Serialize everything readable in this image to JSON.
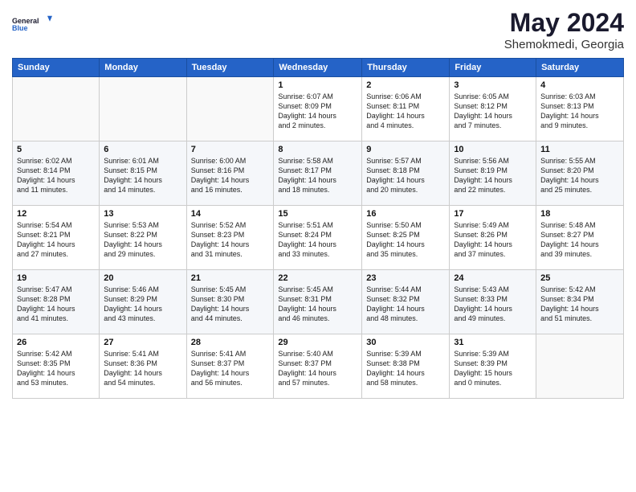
{
  "header": {
    "monthYear": "May 2024",
    "location": "Shemokmedi, Georgia"
  },
  "calendar": {
    "headers": [
      "Sunday",
      "Monday",
      "Tuesday",
      "Wednesday",
      "Thursday",
      "Friday",
      "Saturday"
    ]
  },
  "weeks": [
    [
      {
        "day": "",
        "info": ""
      },
      {
        "day": "",
        "info": ""
      },
      {
        "day": "",
        "info": ""
      },
      {
        "day": "1",
        "info": "Sunrise: 6:07 AM\nSunset: 8:09 PM\nDaylight: 14 hours\nand 2 minutes."
      },
      {
        "day": "2",
        "info": "Sunrise: 6:06 AM\nSunset: 8:11 PM\nDaylight: 14 hours\nand 4 minutes."
      },
      {
        "day": "3",
        "info": "Sunrise: 6:05 AM\nSunset: 8:12 PM\nDaylight: 14 hours\nand 7 minutes."
      },
      {
        "day": "4",
        "info": "Sunrise: 6:03 AM\nSunset: 8:13 PM\nDaylight: 14 hours\nand 9 minutes."
      }
    ],
    [
      {
        "day": "5",
        "info": "Sunrise: 6:02 AM\nSunset: 8:14 PM\nDaylight: 14 hours\nand 11 minutes."
      },
      {
        "day": "6",
        "info": "Sunrise: 6:01 AM\nSunset: 8:15 PM\nDaylight: 14 hours\nand 14 minutes."
      },
      {
        "day": "7",
        "info": "Sunrise: 6:00 AM\nSunset: 8:16 PM\nDaylight: 14 hours\nand 16 minutes."
      },
      {
        "day": "8",
        "info": "Sunrise: 5:58 AM\nSunset: 8:17 PM\nDaylight: 14 hours\nand 18 minutes."
      },
      {
        "day": "9",
        "info": "Sunrise: 5:57 AM\nSunset: 8:18 PM\nDaylight: 14 hours\nand 20 minutes."
      },
      {
        "day": "10",
        "info": "Sunrise: 5:56 AM\nSunset: 8:19 PM\nDaylight: 14 hours\nand 22 minutes."
      },
      {
        "day": "11",
        "info": "Sunrise: 5:55 AM\nSunset: 8:20 PM\nDaylight: 14 hours\nand 25 minutes."
      }
    ],
    [
      {
        "day": "12",
        "info": "Sunrise: 5:54 AM\nSunset: 8:21 PM\nDaylight: 14 hours\nand 27 minutes."
      },
      {
        "day": "13",
        "info": "Sunrise: 5:53 AM\nSunset: 8:22 PM\nDaylight: 14 hours\nand 29 minutes."
      },
      {
        "day": "14",
        "info": "Sunrise: 5:52 AM\nSunset: 8:23 PM\nDaylight: 14 hours\nand 31 minutes."
      },
      {
        "day": "15",
        "info": "Sunrise: 5:51 AM\nSunset: 8:24 PM\nDaylight: 14 hours\nand 33 minutes."
      },
      {
        "day": "16",
        "info": "Sunrise: 5:50 AM\nSunset: 8:25 PM\nDaylight: 14 hours\nand 35 minutes."
      },
      {
        "day": "17",
        "info": "Sunrise: 5:49 AM\nSunset: 8:26 PM\nDaylight: 14 hours\nand 37 minutes."
      },
      {
        "day": "18",
        "info": "Sunrise: 5:48 AM\nSunset: 8:27 PM\nDaylight: 14 hours\nand 39 minutes."
      }
    ],
    [
      {
        "day": "19",
        "info": "Sunrise: 5:47 AM\nSunset: 8:28 PM\nDaylight: 14 hours\nand 41 minutes."
      },
      {
        "day": "20",
        "info": "Sunrise: 5:46 AM\nSunset: 8:29 PM\nDaylight: 14 hours\nand 43 minutes."
      },
      {
        "day": "21",
        "info": "Sunrise: 5:45 AM\nSunset: 8:30 PM\nDaylight: 14 hours\nand 44 minutes."
      },
      {
        "day": "22",
        "info": "Sunrise: 5:45 AM\nSunset: 8:31 PM\nDaylight: 14 hours\nand 46 minutes."
      },
      {
        "day": "23",
        "info": "Sunrise: 5:44 AM\nSunset: 8:32 PM\nDaylight: 14 hours\nand 48 minutes."
      },
      {
        "day": "24",
        "info": "Sunrise: 5:43 AM\nSunset: 8:33 PM\nDaylight: 14 hours\nand 49 minutes."
      },
      {
        "day": "25",
        "info": "Sunrise: 5:42 AM\nSunset: 8:34 PM\nDaylight: 14 hours\nand 51 minutes."
      }
    ],
    [
      {
        "day": "26",
        "info": "Sunrise: 5:42 AM\nSunset: 8:35 PM\nDaylight: 14 hours\nand 53 minutes."
      },
      {
        "day": "27",
        "info": "Sunrise: 5:41 AM\nSunset: 8:36 PM\nDaylight: 14 hours\nand 54 minutes."
      },
      {
        "day": "28",
        "info": "Sunrise: 5:41 AM\nSunset: 8:37 PM\nDaylight: 14 hours\nand 56 minutes."
      },
      {
        "day": "29",
        "info": "Sunrise: 5:40 AM\nSunset: 8:37 PM\nDaylight: 14 hours\nand 57 minutes."
      },
      {
        "day": "30",
        "info": "Sunrise: 5:39 AM\nSunset: 8:38 PM\nDaylight: 14 hours\nand 58 minutes."
      },
      {
        "day": "31",
        "info": "Sunrise: 5:39 AM\nSunset: 8:39 PM\nDaylight: 15 hours\nand 0 minutes."
      },
      {
        "day": "",
        "info": ""
      }
    ]
  ]
}
